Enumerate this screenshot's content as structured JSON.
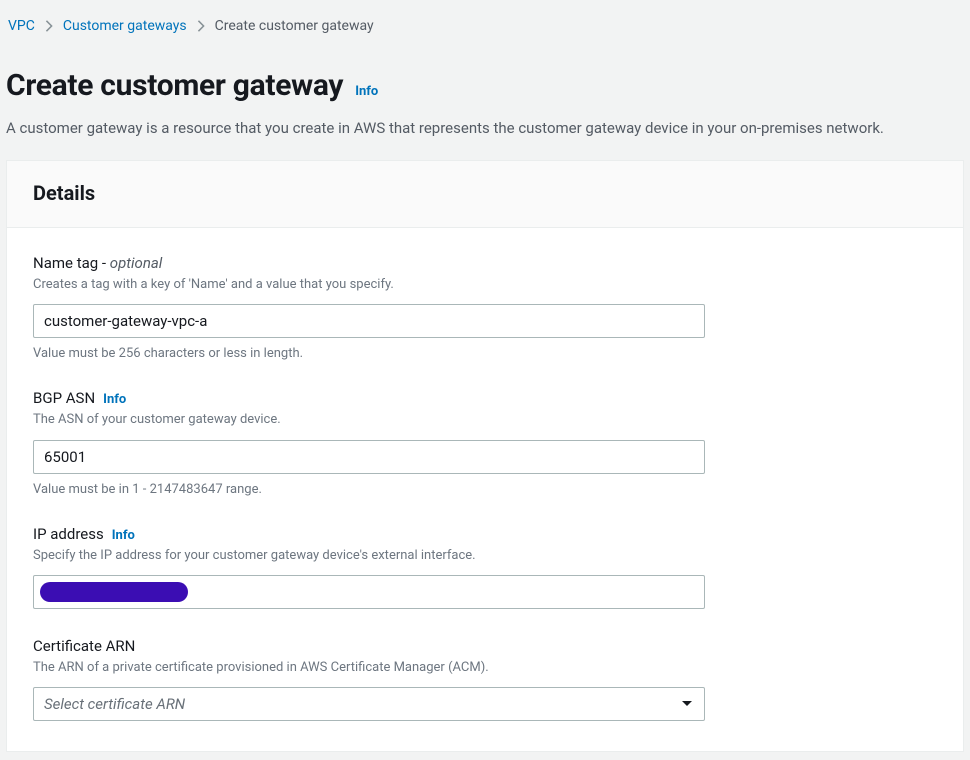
{
  "breadcrumb": {
    "vpc": "VPC",
    "customer_gateways": "Customer gateways",
    "current": "Create customer gateway"
  },
  "header": {
    "title": "Create customer gateway",
    "info": "Info",
    "subtitle": "A customer gateway is a resource that you create in AWS that represents the customer gateway device in your on-premises network."
  },
  "panel": {
    "title": "Details"
  },
  "fields": {
    "name_tag": {
      "label": "Name tag - ",
      "optional": "optional",
      "help": "Creates a tag with a key of 'Name' and a value that you specify.",
      "value": "customer-gateway-vpc-a",
      "hint": "Value must be 256 characters or less in length."
    },
    "bgp_asn": {
      "label": "BGP ASN",
      "info": "Info",
      "help": "The ASN of your customer gateway device.",
      "value": "65001",
      "hint": "Value must be in 1 - 2147483647 range."
    },
    "ip_address": {
      "label": "IP address",
      "info": "Info",
      "help": "Specify the IP address for your customer gateway device's external interface."
    },
    "certificate_arn": {
      "label": "Certificate ARN",
      "help": "The ARN of a private certificate provisioned in AWS Certificate Manager (ACM).",
      "placeholder": "Select certificate ARN"
    }
  }
}
